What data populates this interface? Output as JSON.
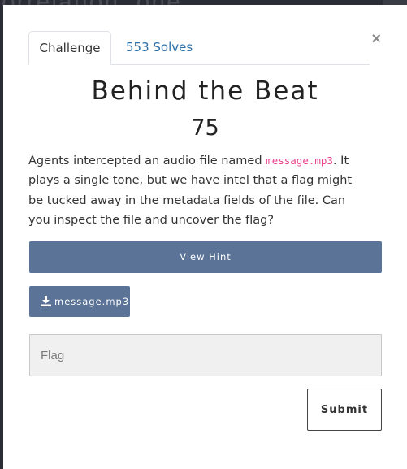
{
  "backdrop": {
    "text": "orrelation .one"
  },
  "modal": {
    "close_label": "×",
    "tabs": [
      {
        "label": "Challenge",
        "active": true
      },
      {
        "label": "553 Solves",
        "active": false
      }
    ],
    "title": "Behind the Beat",
    "points": "75",
    "description": {
      "before": "Agents intercepted an audio file named ",
      "code": "message.mp3",
      "after": ". It plays a single tone, but we have intel that a flag might be tucked away in the metadata fields of the file. Can you inspect the file and uncover the flag?"
    },
    "hint_button": "View Hint",
    "file": {
      "icon": "download-icon",
      "label": "message.mp3"
    },
    "flag_input": {
      "placeholder": "Flag",
      "value": ""
    },
    "submit_button": "Submit"
  },
  "colors": {
    "primary_button": "#5a7396",
    "link": "#2c6fa8",
    "code": "#e83e8c",
    "backdrop": "#2b2d36"
  }
}
